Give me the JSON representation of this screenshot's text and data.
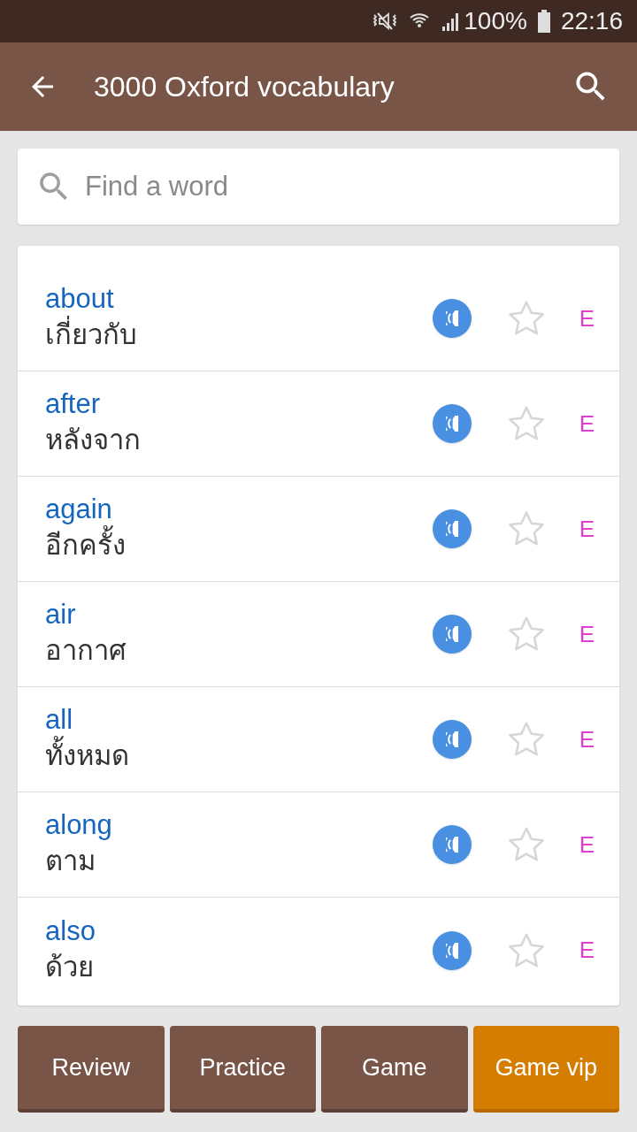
{
  "status_bar": {
    "battery": "100%",
    "time": "22:16"
  },
  "app_bar": {
    "title": "3000 Oxford vocabulary"
  },
  "search": {
    "placeholder": "Find a word"
  },
  "words": [
    {
      "word": "about",
      "translation": "เกี่ยวกับ",
      "starred": false,
      "level": "E"
    },
    {
      "word": "after",
      "translation": "หลังจาก",
      "starred": false,
      "level": "E"
    },
    {
      "word": "again",
      "translation": "อีกครั้ง",
      "starred": false,
      "level": "E"
    },
    {
      "word": "air",
      "translation": "อากาศ",
      "starred": false,
      "level": "E"
    },
    {
      "word": "all",
      "translation": "ทั้งหมด",
      "starred": false,
      "level": "E"
    },
    {
      "word": "along",
      "translation": "ตาม",
      "starred": false,
      "level": "E"
    },
    {
      "word": "also",
      "translation": "ด้วย",
      "starred": false,
      "level": "E"
    }
  ],
  "buttons": [
    {
      "label": "Review",
      "selected": false
    },
    {
      "label": "Practice",
      "selected": false
    },
    {
      "label": "Game",
      "selected": false
    },
    {
      "label": "Game vip",
      "selected": true
    }
  ]
}
